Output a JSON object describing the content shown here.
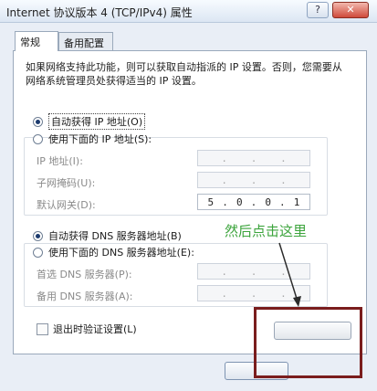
{
  "window": {
    "title": "Internet 协议版本 4 (TCP/IPv4) 属性",
    "help_glyph": "?",
    "close_glyph": "✕"
  },
  "tabs": [
    {
      "label": "常规",
      "active": true
    },
    {
      "label": "备用配置",
      "active": false
    }
  ],
  "description": "如果网络支持此功能，则可以获取自动指派的 IP 设置。否则，您需要从网络系统管理员处获得适当的 IP 设置。",
  "ip": {
    "auto_label": "自动获得 IP 地址(O)",
    "manual_label": "使用下面的 IP 地址(S):",
    "auto_selected": true,
    "fields": [
      {
        "label": "IP 地址(I):",
        "octets": [
          "",
          "",
          "",
          ""
        ],
        "enabled": false
      },
      {
        "label": "子网掩码(U):",
        "octets": [
          "",
          "",
          "",
          ""
        ],
        "enabled": false
      },
      {
        "label": "默认网关(D):",
        "octets": [
          "5",
          "0",
          "0",
          "1"
        ],
        "enabled": true
      }
    ]
  },
  "dns": {
    "auto_label": "自动获得 DNS 服务器地址(B)",
    "manual_label": "使用下面的 DNS 服务器地址(E):",
    "auto_selected": true,
    "fields": [
      {
        "label": "首选 DNS 服务器(P):",
        "octets": [
          "",
          "",
          "",
          ""
        ],
        "enabled": false
      },
      {
        "label": "备用 DNS 服务器(A):",
        "octets": [
          "",
          "",
          "",
          ""
        ],
        "enabled": false
      }
    ]
  },
  "validate_on_exit": {
    "label": "退出时验证设置(L)",
    "checked": false
  },
  "annotation": {
    "text": "然后点击这里",
    "color": "#3ca43c"
  }
}
